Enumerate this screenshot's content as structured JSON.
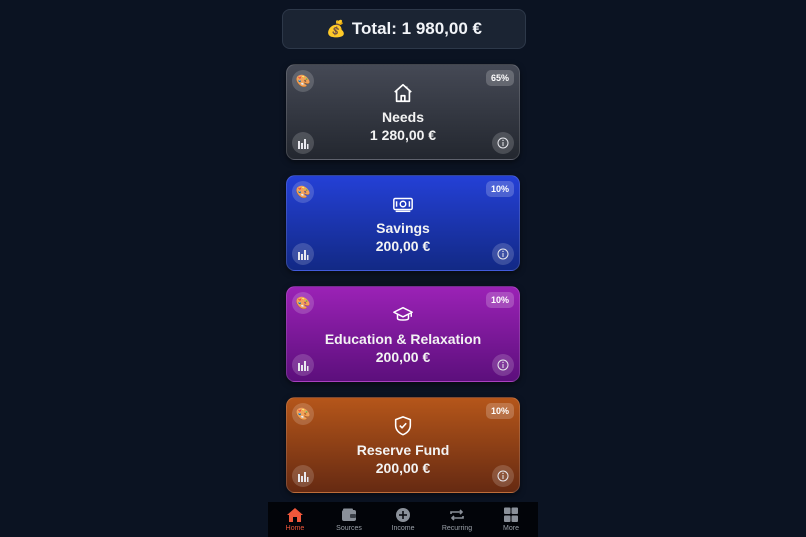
{
  "header": {
    "total_icon": "money-bag-icon",
    "total_label": "Total: 1 980,00 €"
  },
  "cards": [
    {
      "name": "Needs",
      "amount": "1 280,00 €",
      "percent": "65%",
      "icon": "home-icon"
    },
    {
      "name": "Savings",
      "amount": "200,00 €",
      "percent": "10%",
      "icon": "banknote-icon"
    },
    {
      "name": "Education & Relaxation",
      "amount": "200,00 €",
      "percent": "10%",
      "icon": "graduation-cap-icon"
    },
    {
      "name": "Reserve Fund",
      "amount": "200,00 €",
      "percent": "10%",
      "icon": "shield-check-icon"
    }
  ],
  "nav": {
    "items": [
      {
        "label": "Home",
        "icon": "home-icon",
        "active": true
      },
      {
        "label": "Sources",
        "icon": "wallet-icon"
      },
      {
        "label": "Income",
        "icon": "plus-circle-icon"
      },
      {
        "label": "Recurring",
        "icon": "repeat-icon"
      },
      {
        "label": "More",
        "icon": "grid-icon"
      }
    ]
  },
  "colors": {
    "active_nav": "#f0573b",
    "background": "#0b1322"
  }
}
